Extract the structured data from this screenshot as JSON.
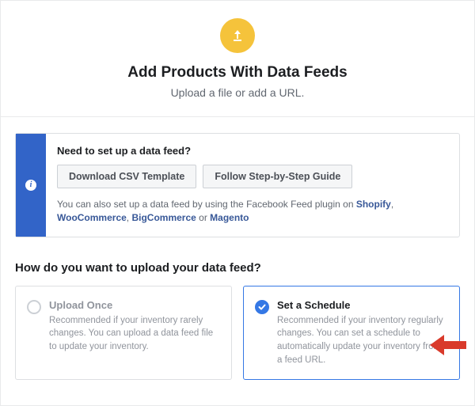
{
  "header": {
    "title": "Add Products With Data Feeds",
    "subtitle": "Upload a file or add a URL."
  },
  "info_box": {
    "title": "Need to set up a data feed?",
    "download_btn": "Download CSV Template",
    "guide_btn": "Follow Step-by-Step Guide",
    "text_prefix": "You can also set up a data feed by using the Facebook Feed plugin on ",
    "links": {
      "shopify": "Shopify",
      "woocommerce": "WooCommerce",
      "bigcommerce": "BigCommerce",
      "magento": "Magento"
    },
    "or": " or ",
    "comma": ", "
  },
  "section": {
    "title": "How do you want to upload your data feed?"
  },
  "options": {
    "upload_once": {
      "title": "Upload Once",
      "desc": "Recommended if your inventory rarely changes. You can upload a data feed file to update your inventory."
    },
    "schedule": {
      "title": "Set a Schedule",
      "desc": "Recommended if your inventory regularly changes. You can set a schedule to automatically update your inventory from a feed URL."
    }
  }
}
